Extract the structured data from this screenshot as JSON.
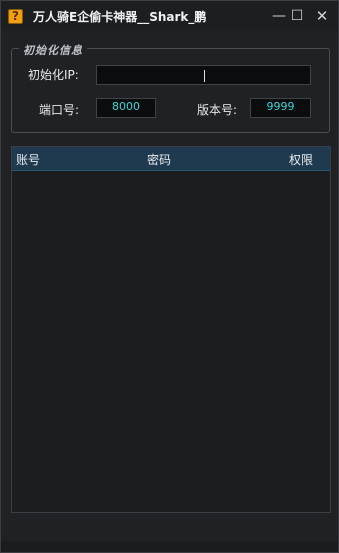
{
  "window": {
    "icon_glyph": "?",
    "title": "万人骑E企偷卡神器__Shark_鹏",
    "controls": {
      "minimize": "—",
      "maximize": "☐",
      "close": "✕"
    }
  },
  "init_group": {
    "legend": "初始化信息",
    "ip_label": "初始化IP:",
    "ip_value": "",
    "port_label": "端口号:",
    "port_value": "8000",
    "version_label": "版本号:",
    "version_value": "9999"
  },
  "table": {
    "columns": [
      "账号",
      "密码",
      "权限"
    ],
    "rows": []
  },
  "colors": {
    "background": "#1f2125",
    "header": "#1f3a4f",
    "field_text": "#37d7d7",
    "app_icon": "#f0a010"
  }
}
